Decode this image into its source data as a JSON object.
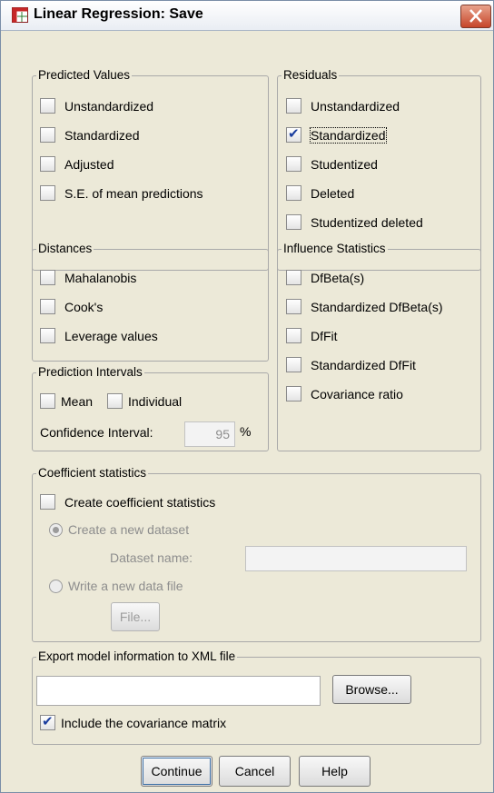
{
  "window": {
    "title": "Linear Regression: Save"
  },
  "predicted_values": {
    "legend": "Predicted Values",
    "items": [
      {
        "label": "Unstandardized",
        "checked": false
      },
      {
        "label": "Standardized",
        "checked": false
      },
      {
        "label": "Adjusted",
        "checked": false
      },
      {
        "label": "S.E. of mean predictions",
        "checked": false
      }
    ]
  },
  "residuals": {
    "legend": "Residuals",
    "items": [
      {
        "label": "Unstandardized",
        "checked": false
      },
      {
        "label": "Standardized",
        "checked": true
      },
      {
        "label": "Studentized",
        "checked": false
      },
      {
        "label": "Deleted",
        "checked": false
      },
      {
        "label": "Studentized deleted",
        "checked": false
      }
    ]
  },
  "distances": {
    "legend": "Distances",
    "items": [
      {
        "label": "Mahalanobis",
        "checked": false
      },
      {
        "label": "Cook's",
        "checked": false
      },
      {
        "label": "Leverage values",
        "checked": false
      }
    ]
  },
  "influence_statistics": {
    "legend": "Influence Statistics",
    "items": [
      {
        "label": "DfBeta(s)",
        "checked": false
      },
      {
        "label": "Standardized DfBeta(s)",
        "checked": false
      },
      {
        "label": "DfFit",
        "checked": false
      },
      {
        "label": "Standardized DfFit",
        "checked": false
      },
      {
        "label": "Covariance ratio",
        "checked": false
      }
    ]
  },
  "prediction_intervals": {
    "legend": "Prediction Intervals",
    "mean_label": "Mean",
    "individual_label": "Individual",
    "confidence_label": "Confidence Interval:",
    "confidence_value": "95",
    "percent": "%"
  },
  "coefficient_statistics": {
    "legend": "Coefficient statistics",
    "create_label": "Create coefficient statistics",
    "new_dataset_label": "Create a new dataset",
    "dataset_name_label": "Dataset name:",
    "dataset_name_value": "",
    "new_file_label": "Write a new data file",
    "file_button": "File..."
  },
  "export_xml": {
    "legend": "Export model information to XML file",
    "path_value": "",
    "browse_button": "Browse...",
    "covariance_label": "Include the covariance matrix",
    "covariance_checked": true
  },
  "footer": {
    "continue": "Continue",
    "cancel": "Cancel",
    "help": "Help"
  },
  "colors": {
    "check": "#1a3d9e",
    "dialog_bg": "#ece9d8",
    "close_button": "#c6452a"
  },
  "icons": [
    "app-table-icon",
    "close-icon"
  ]
}
